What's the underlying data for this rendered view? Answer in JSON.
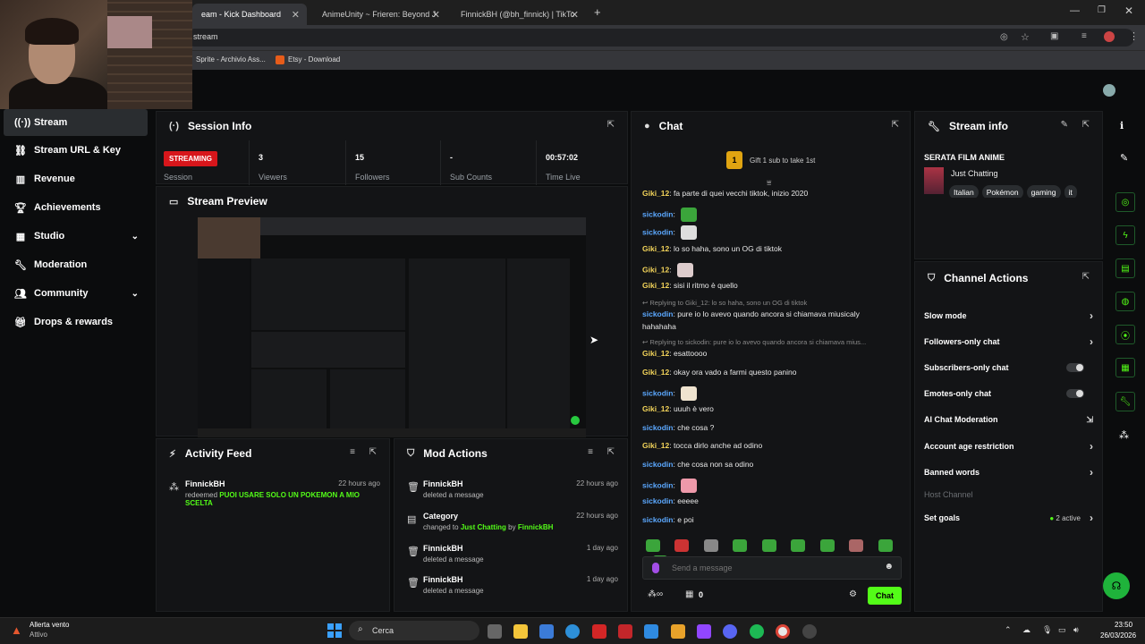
{
  "browser": {
    "tabs": [
      {
        "label": "eam - Kick Dashboard",
        "active": true
      },
      {
        "label": "AnimeUnity ~ Frieren: Beyond J"
      },
      {
        "label": "FinnickBH (@bh_finnick) | TikTo"
      }
    ],
    "url": "stream",
    "bookmarks": [
      "Sprite - Archivio Ass...",
      "Etsy - Download"
    ]
  },
  "sidebar": {
    "items": [
      {
        "label": "Stream",
        "icon": "broadcast-icon",
        "active": true
      },
      {
        "label": "Stream URL & Key",
        "icon": "link-icon"
      },
      {
        "label": "Revenue",
        "icon": "chart-icon"
      },
      {
        "label": "Achievements",
        "icon": "trophy-icon"
      },
      {
        "label": "Studio",
        "icon": "grid-icon",
        "chevron": true
      },
      {
        "label": "Moderation",
        "icon": "wrench-icon"
      },
      {
        "label": "Community",
        "icon": "people-icon",
        "chevron": true
      },
      {
        "label": "Drops & rewards",
        "icon": "gift-icon"
      }
    ]
  },
  "session": {
    "title": "Session Info",
    "status": "STREAMING",
    "session_label": "Session",
    "stats": [
      {
        "value": "3",
        "label": "Viewers"
      },
      {
        "value": "15",
        "label": "Followers"
      },
      {
        "value": "-",
        "label": "Sub Counts"
      },
      {
        "value": "00:57:02",
        "label": "Time Live"
      }
    ]
  },
  "preview": {
    "title": "Stream Preview"
  },
  "activity": {
    "title": "Activity Feed",
    "items": [
      {
        "name": "FinnickBH",
        "time": "22 hours ago",
        "action": "redeemed",
        "reward": "PUOI USARE SOLO UN POKEMON A MIO SCELTA"
      }
    ]
  },
  "mod": {
    "title": "Mod Actions",
    "items": [
      {
        "name": "FinnickBH",
        "time": "22 hours ago",
        "desc": "deleted a message"
      },
      {
        "name": "Category",
        "time": "22 hours ago",
        "desc_pre": "changed to",
        "cat": "Just Chatting",
        "by": "by",
        "who": "FinnickBH"
      },
      {
        "name": "FinnickBH",
        "time": "1 day ago",
        "desc": "deleted a message"
      },
      {
        "name": "FinnickBH",
        "time": "1 day ago",
        "desc": "deleted a message"
      }
    ]
  },
  "chat": {
    "title": "Chat",
    "gift_rank": "1",
    "gift_text": "Gift 1 sub to take 1st",
    "messages": [
      {
        "user": "Giki_12",
        "text": "fa parte di quei vecchi tiktok, inizio 2020"
      },
      {
        "user": "sickodin",
        "text": ""
      },
      {
        "user": "sickodin",
        "text": ""
      },
      {
        "user": "Giki_12",
        "text": "lo so haha, sono un OG di tiktok"
      },
      {
        "user": "Giki_12",
        "text": ""
      },
      {
        "user": "Giki_12",
        "text": "sisi il ritmo è quello"
      },
      {
        "reply": "Replying to Giki_12: lo so haha, sono un OG di tiktok"
      },
      {
        "user": "sickodin",
        "text": "pure io lo avevo quando ancora si chiamava miusicaly"
      },
      {
        "cont": "hahahaha"
      },
      {
        "reply": "Replying to sickodin: pure io lo avevo quando ancora si chiamava mius..."
      },
      {
        "user": "Giki_12",
        "text": "esattoooo"
      },
      {
        "user": "Giki_12",
        "text": "okay ora vado a farmi questo panino"
      },
      {
        "user": "sickodin",
        "text": ""
      },
      {
        "user": "Giki_12",
        "text": "uuuh è vero"
      },
      {
        "user": "sickodin",
        "text": "che cosa ?"
      },
      {
        "user": "Giki_12",
        "text": "tocca dirlo anche ad odino"
      },
      {
        "user": "sickodin",
        "text": "che cosa non sa odino"
      },
      {
        "user": "sickodin",
        "text": ""
      },
      {
        "user": "sickodin",
        "text": "eeeee"
      },
      {
        "user": "sickodin",
        "text": "e poi"
      }
    ],
    "placeholder": "Send a message",
    "points": "0",
    "send_label": "Chat"
  },
  "stream_info": {
    "title": "Stream info",
    "stream_title": "SERATA FILM ANIME",
    "category": "Just Chatting",
    "tags": [
      "Italian",
      "Pokémon",
      "gaming",
      "it"
    ]
  },
  "channel_actions": {
    "title": "Channel Actions",
    "items": [
      {
        "label": "Slow mode",
        "kind": "arrow"
      },
      {
        "label": "Followers-only chat",
        "kind": "arrow"
      },
      {
        "label": "Subscribers-only chat",
        "kind": "toggle"
      },
      {
        "label": "Emotes-only chat",
        "kind": "toggle"
      },
      {
        "label": "AI Chat Moderation",
        "kind": "external"
      },
      {
        "label": "Account age restriction",
        "kind": "arrow"
      },
      {
        "label": "Banned words",
        "kind": "arrow"
      },
      {
        "label": "Host Channel",
        "kind": "disabled"
      },
      {
        "label": "Set goals",
        "kind": "goals",
        "extra": "2 active"
      }
    ]
  },
  "taskbar": {
    "weather_title": "Allerta vento",
    "weather_sub": "Attivo",
    "search": "Cerca",
    "time": "23:50",
    "date": "26/03/2026"
  },
  "colors": {
    "accent": "#53fc18",
    "live": "#d7161b",
    "panel": "#131416"
  }
}
